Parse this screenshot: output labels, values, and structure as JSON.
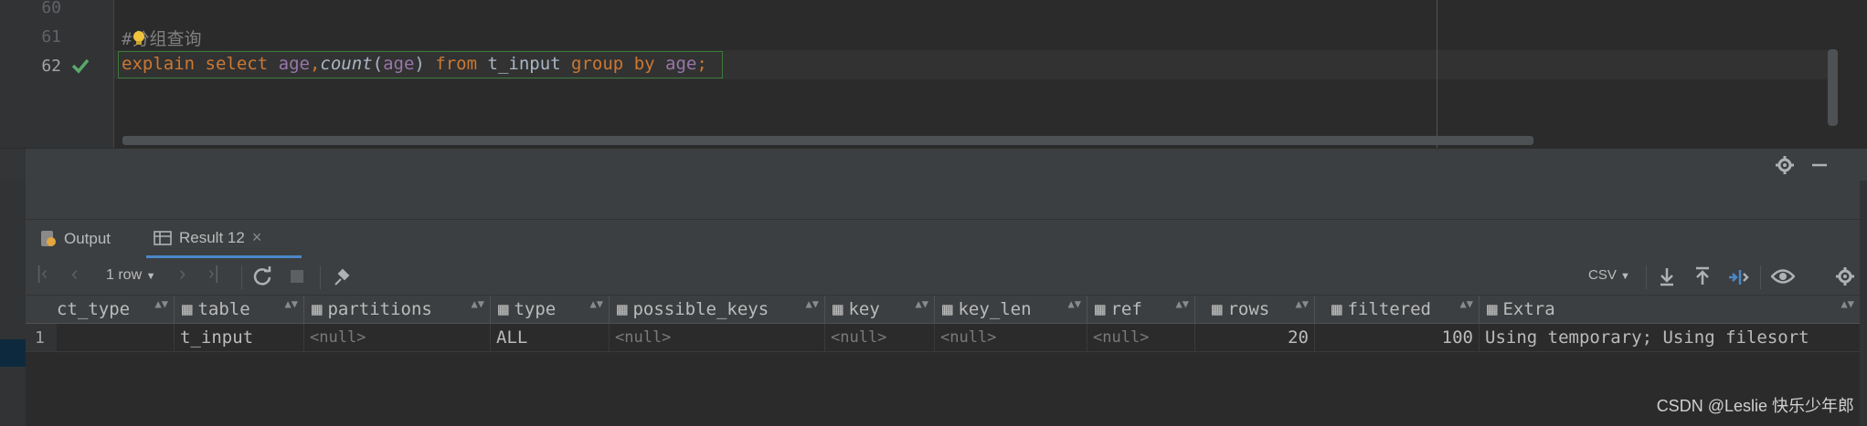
{
  "editor": {
    "lines": [
      {
        "num": "60",
        "text": ""
      },
      {
        "num": "61",
        "text": "#分组查询"
      },
      {
        "num": "62",
        "text": ""
      }
    ],
    "query": {
      "kw_explain": "explain",
      "kw_select": "select",
      "col_age": "age",
      "comma": ",",
      "fn_count": "count",
      "paren_open": "(",
      "col_age2": "age",
      "paren_close": ")",
      "kw_from": "from",
      "table": "t_input",
      "kw_group": "group",
      "kw_by": "by",
      "col_age3": "age",
      "semicolon": ";"
    }
  },
  "panel": {
    "tabs": [
      {
        "label": "Output",
        "icon": "output-icon"
      },
      {
        "label": "Result 12",
        "icon": "table-icon",
        "close": "×"
      }
    ],
    "toolbar": {
      "row_count": "1 row",
      "export_format": "CSV"
    }
  },
  "grid": {
    "columns": [
      "ct_type",
      "table",
      "partitions",
      "type",
      "possible_keys",
      "key",
      "key_len",
      "ref",
      "rows",
      "filtered",
      "Extra"
    ],
    "rows": [
      {
        "num": "1",
        "cells": [
          "",
          "t_input",
          "<null>",
          "ALL",
          "<null>",
          "<null>",
          "<null>",
          "<null>",
          "20",
          "100",
          "Using temporary; Using filesort"
        ]
      }
    ]
  },
  "watermark": "CSDN @Leslie 快乐少年郎",
  "colors": {
    "keyword": "#cc7832",
    "column": "#9876aa",
    "tab_active_underline": "#4a88c7",
    "check_green": "#59a869"
  }
}
